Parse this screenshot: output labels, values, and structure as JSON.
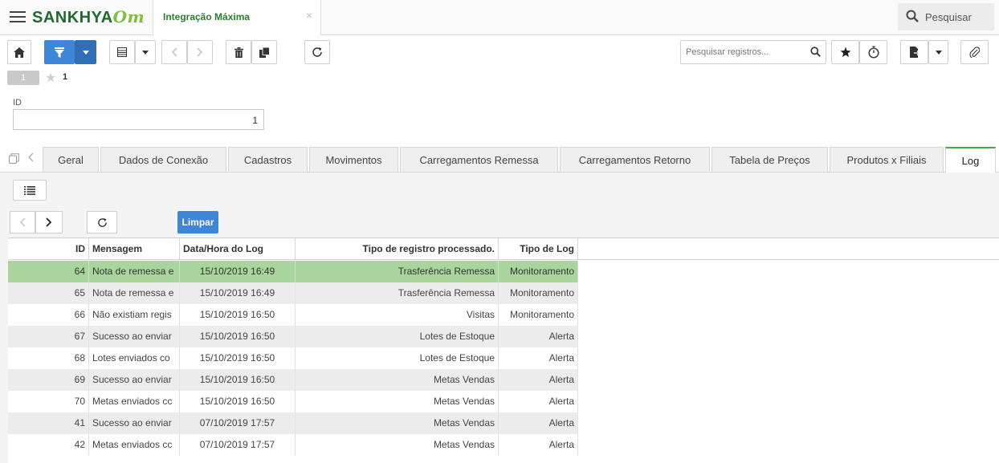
{
  "header": {
    "logo_text": "SANKHYA",
    "logo_suffix": "Om",
    "app_tab_title": "Integração Máxima",
    "app_tab_close": "×",
    "search_label": "Pesquisar"
  },
  "toolbar": {
    "record_search_placeholder": "Pesquisar registros..."
  },
  "record_nav": {
    "badge": "1",
    "count": "1"
  },
  "form": {
    "id_label": "ID",
    "id_value": "1"
  },
  "tabs": [
    {
      "label": "Geral"
    },
    {
      "label": "Dados de Conexão"
    },
    {
      "label": "Cadastros"
    },
    {
      "label": "Movimentos"
    },
    {
      "label": "Carregamentos Remessa"
    },
    {
      "label": "Carregamentos Retorno"
    },
    {
      "label": "Tabela de Preços"
    },
    {
      "label": "Produtos x Filiais"
    },
    {
      "label": "Log"
    }
  ],
  "active_tab": "Log",
  "log": {
    "limpar_label": "Limpar",
    "columns": {
      "id": "ID",
      "mensagem": "Mensagem",
      "datahora": "Data/Hora do Log",
      "tipo_registro": "Tipo de registro processado.",
      "tipo_log": "Tipo de Log"
    },
    "rows": [
      {
        "id": "64",
        "mensagem": "Nota de remessa e",
        "datahora": "15/10/2019 16:49",
        "tipo_registro": "Trasferência Remessa",
        "tipo_log": "Monitoramento"
      },
      {
        "id": "65",
        "mensagem": "Nota de remessa e",
        "datahora": "15/10/2019 16:49",
        "tipo_registro": "Trasferência Remessa",
        "tipo_log": "Monitoramento"
      },
      {
        "id": "66",
        "mensagem": "Não existiam regis",
        "datahora": "15/10/2019 16:50",
        "tipo_registro": "Visitas",
        "tipo_log": "Monitoramento"
      },
      {
        "id": "67",
        "mensagem": "Sucesso ao enviar",
        "datahora": "15/10/2019 16:50",
        "tipo_registro": "Lotes de Estoque",
        "tipo_log": "Alerta"
      },
      {
        "id": "68",
        "mensagem": "Lotes enviados co",
        "datahora": "15/10/2019 16:50",
        "tipo_registro": "Lotes de Estoque",
        "tipo_log": "Alerta"
      },
      {
        "id": "69",
        "mensagem": "Sucesso ao enviar",
        "datahora": "15/10/2019 16:50",
        "tipo_registro": "Metas Vendas",
        "tipo_log": "Alerta"
      },
      {
        "id": "70",
        "mensagem": "Metas enviados cc",
        "datahora": "15/10/2019 16:50",
        "tipo_registro": "Metas Vendas",
        "tipo_log": "Alerta"
      },
      {
        "id": "41",
        "mensagem": "Sucesso ao enviar",
        "datahora": "07/10/2019 17:57",
        "tipo_registro": "Metas Vendas",
        "tipo_log": "Alerta"
      },
      {
        "id": "42",
        "mensagem": "Metas enviados cc",
        "datahora": "07/10/2019 17:57",
        "tipo_registro": "Metas Vendas",
        "tipo_log": "Alerta"
      }
    ],
    "selected_row": "64"
  },
  "colors": {
    "brand_green": "#1e6b2b",
    "accent_blue": "#3d86d8",
    "selected_row": "#a9d49d",
    "active_tab_border": "#4aa54a"
  }
}
